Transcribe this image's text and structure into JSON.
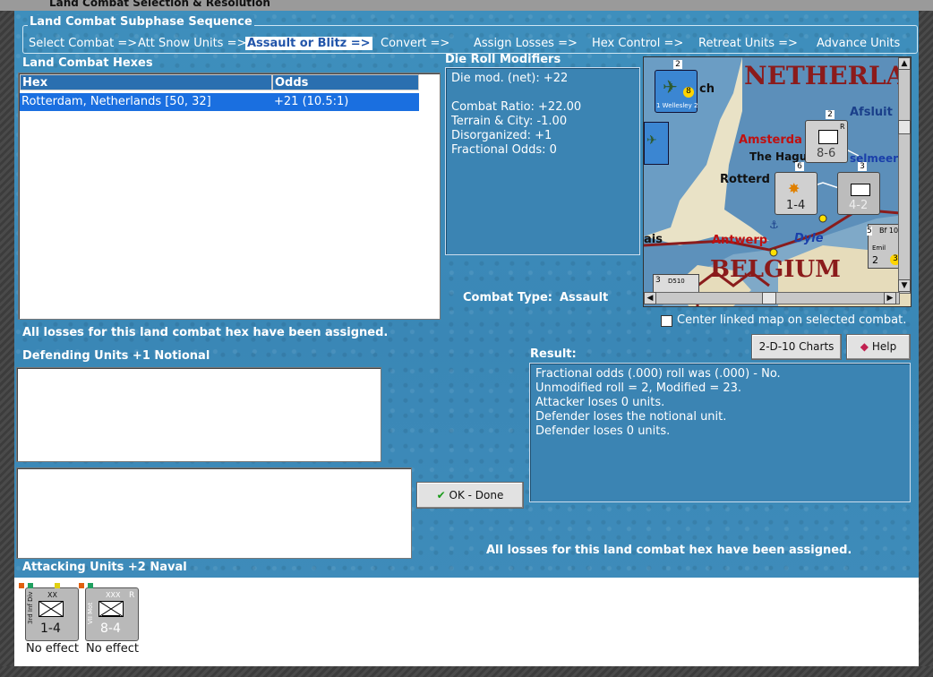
{
  "window": {
    "title": "Land Combat Selection & Resolution"
  },
  "sequence": {
    "title": "Land Combat Subphase Sequence",
    "steps": [
      "Select Combat =>",
      "Att Snow Units =>",
      "Assault or Blitz =>",
      "Convert =>",
      "Assign Losses =>",
      "Hex Control =>",
      "Retreat Units =>",
      "Advance Units"
    ],
    "active_index": 2
  },
  "hexes": {
    "title": "Land Combat Hexes",
    "columns": [
      "Hex",
      "Odds"
    ],
    "rows": [
      {
        "hex": "Rotterdam, Netherlands [50, 32]",
        "odds": "+21 (10.5:1)"
      }
    ]
  },
  "modifiers": {
    "title": "Die Roll Modifiers",
    "lines": [
      "Die mod. (net): +22",
      "",
      "Combat Ratio: +22.00",
      "Terrain & City: -1.00",
      "Disorganized: +1",
      "Fractional Odds: 0"
    ]
  },
  "combat_type": {
    "label": "Combat Type:",
    "value": "Assault"
  },
  "map": {
    "labels": {
      "netherlands": "NETHERLA",
      "belgium": "BELGIUM",
      "amsterdam": "Amsterda",
      "the_hague": "The Hagu",
      "rotterdam": "Rotterd",
      "antwerp": "Antwerp",
      "dyle": "Dyle",
      "afsluit": "Afsluit",
      "ijsselmeer": "selmeer",
      "ch": "ch",
      "ais": "ais"
    },
    "counters": {
      "wellesley": {
        "strength": "8",
        "name": "1 Wellesley 2",
        "stack": "2"
      },
      "nl_corps": {
        "value": "8-6",
        "stack": "2",
        "tag": "R"
      },
      "inf": {
        "value": "1-4",
        "stack": "6"
      },
      "german": {
        "value": "4-2",
        "stack": "3"
      },
      "air": {
        "name": "Bf 10",
        "sub": "Emil",
        "val1": "2",
        "val2": "3",
        "stack": "5"
      },
      "ship": {
        "name": "D510",
        "stack": "3"
      }
    },
    "center_checkbox": {
      "label": "Center linked map on selected combat.",
      "checked": false
    }
  },
  "buttons": {
    "charts": "2-D-10 Charts",
    "help": "Help",
    "ok": "OK - Done"
  },
  "status_top": "All losses for this land combat hex have been assigned.",
  "status_bottom": "All losses for this land combat hex have been assigned.",
  "defending": {
    "title": "Defending Units +1 Notional"
  },
  "result": {
    "title": "Result:",
    "lines": [
      "Fractional odds (.000) roll was (.000)  - No.",
      "Unmodified roll = 2, Modified = 23.",
      "Attacker loses 0 units.",
      "Defender loses the notional unit.",
      "Defender loses 0 units."
    ]
  },
  "attacking": {
    "title": "Attacking Units +2 Naval",
    "units": [
      {
        "name": "3rd Inf Div",
        "size": "XX",
        "value": "1-4",
        "effect": "No effect",
        "tag": ""
      },
      {
        "name": "VII Mot",
        "size": "XXX",
        "value": "8-4",
        "effect": "No effect",
        "tag": "R"
      }
    ]
  }
}
